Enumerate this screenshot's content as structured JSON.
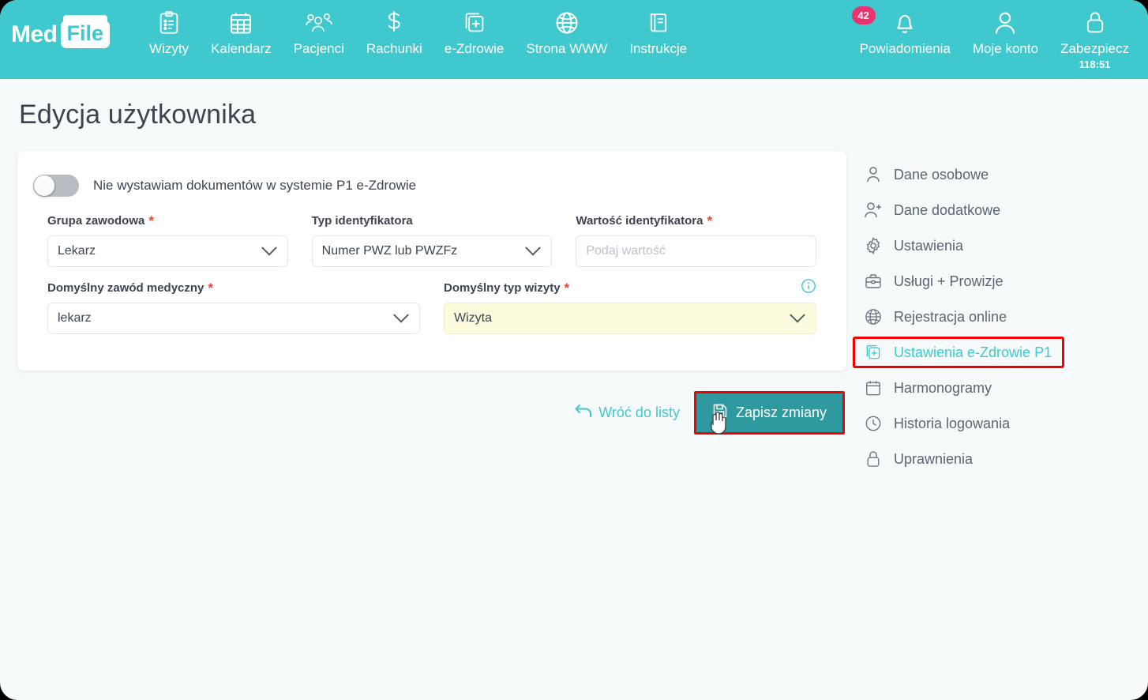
{
  "brand": {
    "logo_left": "Med",
    "logo_right": "File"
  },
  "topnav": {
    "left_items": [
      {
        "label": "Wizyty",
        "icon": "clipboard-icon"
      },
      {
        "label": "Kalendarz",
        "icon": "calendar-icon"
      },
      {
        "label": "Pacjenci",
        "icon": "users-icon"
      },
      {
        "label": "Rachunki",
        "icon": "dollar-icon"
      },
      {
        "label": "e-Zdrowie",
        "icon": "ehealth-card-icon"
      },
      {
        "label": "Strona WWW",
        "icon": "globe-icon"
      },
      {
        "label": "Instrukcje",
        "icon": "book-icon"
      }
    ],
    "right_items": [
      {
        "label": "Powiadomienia",
        "icon": "bell-icon",
        "badge": "42"
      },
      {
        "label": "Moje konto",
        "icon": "user-icon"
      },
      {
        "label": "Zabezpiecz",
        "icon": "lock-icon",
        "sub": "118:51"
      }
    ]
  },
  "page": {
    "title": "Edycja użytkownika"
  },
  "form": {
    "toggle": {
      "label": "Nie wystawiam dokumentów w systemie P1 e-Zdrowie",
      "state": "off"
    },
    "fields": [
      {
        "label": "Grupa zawodowa",
        "required": true,
        "value": "Lekarz",
        "type": "select"
      },
      {
        "label": "Typ identyfikatora",
        "required": false,
        "value": "Numer PWZ lub PWZFz",
        "type": "select"
      },
      {
        "label": "Wartość identyfikatora",
        "required": true,
        "placeholder": "Podaj wartość",
        "value": "",
        "type": "text"
      },
      {
        "label": "Domyślny zawód medyczny",
        "required": true,
        "value": "lekarz",
        "type": "select"
      },
      {
        "label": "Domyślny typ wizyty",
        "required": true,
        "value": "Wizyta",
        "type": "select",
        "highlight": true,
        "info_icon": "info-icon"
      }
    ]
  },
  "actions": {
    "back_label": "Wróć do listy",
    "back_icon": "arrow-back-icon",
    "save_label": "Zapisz zmiany",
    "save_icon": "save-disk-icon"
  },
  "sidebar": {
    "items": [
      {
        "label": "Dane osobowe",
        "icon": "user-icon",
        "active": false
      },
      {
        "label": "Dane dodatkowe",
        "icon": "user-plus-icon",
        "active": false
      },
      {
        "label": "Ustawienia",
        "icon": "gear-icon",
        "active": false
      },
      {
        "label": "Usługi + Prowizje",
        "icon": "briefcase-icon",
        "active": false
      },
      {
        "label": "Rejestracja online",
        "icon": "globe-icon",
        "active": false
      },
      {
        "label": "Ustawienia e-Zdrowie P1",
        "icon": "ehealth-card-icon",
        "active": true
      },
      {
        "label": "Harmonogramy",
        "icon": "calendar-icon",
        "active": false
      },
      {
        "label": "Historia logowania",
        "icon": "clock-icon",
        "active": false
      },
      {
        "label": "Uprawnienia",
        "icon": "lock-icon",
        "active": false
      }
    ]
  },
  "colors": {
    "brand_teal": "#3fc9cf",
    "save_button": "#2e9aa0",
    "badge_pink": "#e8346e",
    "highlight_red": "#f40000",
    "required_red": "#ef4136",
    "field_yellow": "#fcfbdd"
  }
}
